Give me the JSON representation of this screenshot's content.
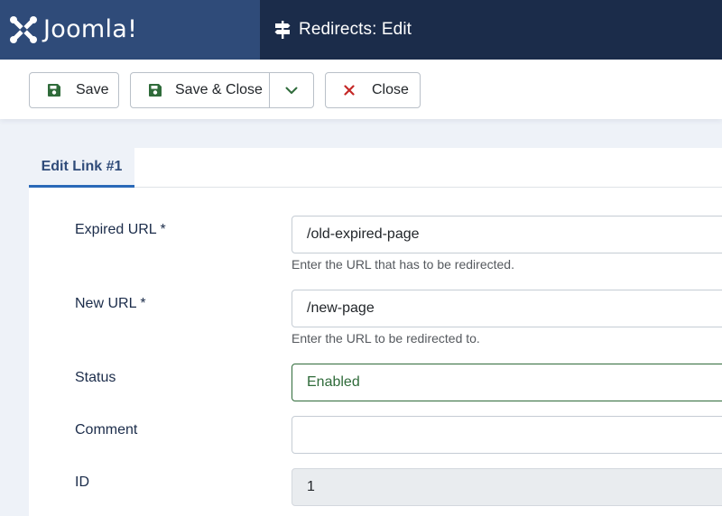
{
  "brand": {
    "name": "Joomla!",
    "logo_icon": "joomla-logo-icon"
  },
  "header": {
    "title": "Redirects: Edit",
    "icon": "signpost-icon"
  },
  "toolbar": {
    "save_label": "Save",
    "save_close_label": "Save & Close",
    "close_label": "Close",
    "icons": {
      "save": "floppy-disk-icon",
      "dropdown": "chevron-down-icon",
      "close": "x-icon"
    }
  },
  "tabs": [
    {
      "label": "Edit Link #1"
    }
  ],
  "form": {
    "expired_url": {
      "label": "Expired URL *",
      "value": "/old-expired-page",
      "help": "Enter the URL that has to be redirected."
    },
    "new_url": {
      "label": "New URL *",
      "value": "/new-page",
      "help": "Enter the URL to be redirected to."
    },
    "status": {
      "label": "Status",
      "value": "Enabled"
    },
    "comment": {
      "label": "Comment",
      "value": ""
    },
    "id": {
      "label": "ID",
      "value": "1"
    }
  },
  "colors": {
    "header_bg": "#1b2c4a",
    "brand_bg": "#2f4b79",
    "save_icon": "#2f6b3a",
    "close_icon": "#c52827",
    "tab_accent": "#2a69b8",
    "status_green": "#2f6b3a"
  }
}
